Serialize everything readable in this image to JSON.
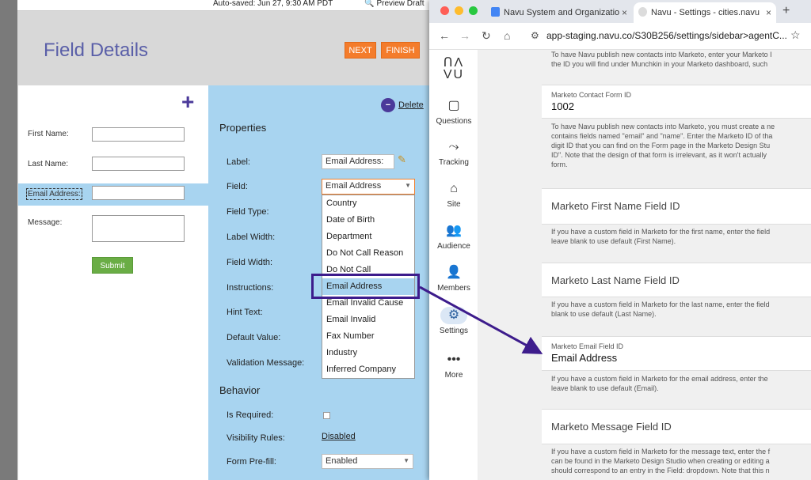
{
  "marketo": {
    "autosave": "Auto-saved: Jun 27, 9:30 AM PDT",
    "preview": "Preview Draft",
    "title": "Field Details",
    "next": "NEXT",
    "finish": "FINISH",
    "form": {
      "first_name": "First Name:",
      "last_name": "Last Name:",
      "email": "Email Address:",
      "message": "Message:",
      "submit": "Submit"
    },
    "delete": "Delete",
    "properties_heading": "Properties",
    "labels": {
      "label": "Label:",
      "field": "Field:",
      "field_type": "Field Type:",
      "label_width": "Label Width:",
      "field_width": "Field Width:",
      "instructions": "Instructions:",
      "hint_text": "Hint Text:",
      "default_value": "Default Value:",
      "validation": "Validation Message:",
      "is_required": "Is Required:",
      "visibility": "Visibility Rules:",
      "prefill": "Form Pre-fill:"
    },
    "label_value": "Email Address:",
    "field_value": "Email Address",
    "behavior_heading": "Behavior",
    "visibility_value": "Disabled",
    "prefill_value": "Enabled",
    "field_options": [
      "Country",
      "Date of Birth",
      "Department",
      "Do Not Call Reason",
      "Do Not Call",
      "Email Address",
      "Email Invalid Cause",
      "Email Invalid",
      "Fax Number",
      "Industry",
      "Inferred Company"
    ],
    "selected_option": "Email Address"
  },
  "browser": {
    "tab1": "Navu System and Organizatio",
    "tab2": "Navu - Settings - cities.navu",
    "url": "app-staging.navu.co/S30B256/settings/sidebar>agentC..."
  },
  "navu": {
    "logo_top": "ՈΛ",
    "logo_bottom": "VU",
    "nav": [
      {
        "label": "Questions",
        "icon": "chat-icon"
      },
      {
        "label": "Tracking",
        "icon": "route-icon"
      },
      {
        "label": "Site",
        "icon": "home-icon"
      },
      {
        "label": "Audience",
        "icon": "people-icon"
      },
      {
        "label": "Members",
        "icon": "person-icon"
      },
      {
        "label": "Settings",
        "icon": "gear-icon"
      },
      {
        "label": "More",
        "icon": "more-icon"
      }
    ],
    "top_help": [
      "To have Navu publish new contacts into Marketo, enter your Marketo I",
      "the ID you will find under Munchkin in your Marketo dashboard, such"
    ],
    "form_id": {
      "label": "Marketo Contact Form ID",
      "value": "1002"
    },
    "form_help": [
      "To have Navu publish new contacts into Marketo, you must create a ne",
      "contains fields named \"email\" and \"name\". Enter the Marketo ID of tha",
      "digit ID that you can find on the Form page in the Marketo Design Stu",
      "ID\". Note that the design of that form is irrelevant, as it won't actually",
      "form."
    ],
    "first_name": {
      "title": "Marketo First Name Field ID"
    },
    "first_help": [
      "If you have a custom field in Marketo for the first name, enter the field",
      "leave blank to use default (First Name)."
    ],
    "last_name": {
      "title": "Marketo Last Name Field ID"
    },
    "last_help": [
      "If you have a custom field in Marketo for the last name, enter the field",
      "blank to use default (Last Name)."
    ],
    "email": {
      "label": "Marketo Email Field ID",
      "value": "Email Address"
    },
    "email_help": [
      "If you have a custom field in Marketo for the email address, enter the",
      "leave blank to use default (Email)."
    ],
    "message": {
      "title": "Marketo Message Field ID"
    },
    "message_help": [
      "If you have a custom field in Marketo for the message text, enter the f",
      "can be found in the Marketo Design Studio when creating or editing a",
      "should correspond to an entry in the Field: dropdown. Note that this n"
    ]
  }
}
